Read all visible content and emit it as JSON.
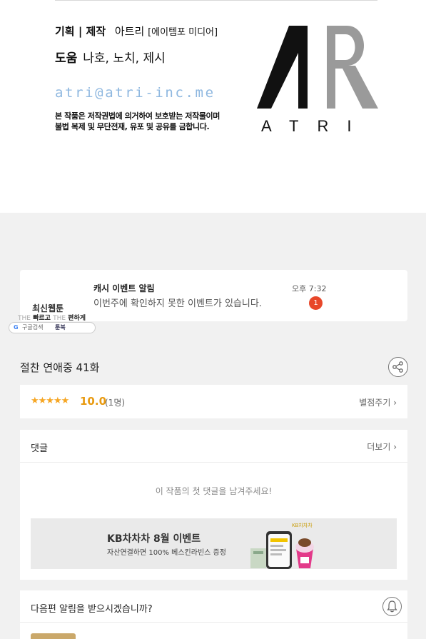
{
  "credits": {
    "plan_label": "기획 | 제작",
    "plan_value": "아트리",
    "plan_extra": "[에이템포 미디어]",
    "help_label": "도움",
    "help_value": "나호, 노치, 제시",
    "email": "atri@atri-inc.me",
    "notice_line1": "본 작품은 저작권법에 의거하여 보호받는 저작물이며",
    "notice_line2": "불법 복제 및 무단전재, 유포 및 공유를 금합니다.",
    "logo_text": "ATRI"
  },
  "notification": {
    "title": "캐시 이벤트 알림",
    "body": "이번주에 확인하지 못한 이벤트가 있습니다.",
    "time": "오후 7:32",
    "badge": "1"
  },
  "ad_logo": {
    "title": "최신웹툰",
    "tagline_a": "THE",
    "tagline_b": "빠르고",
    "tagline_c": "THE",
    "tagline_d": "편하게",
    "pill_search": "구글검색",
    "pill_name": "툰북"
  },
  "episode": {
    "title": "절찬 연애중 41화"
  },
  "rating": {
    "stars": "★★★★★",
    "score": "10.0",
    "count": "(1명)",
    "rate_link": "별점주기 ›"
  },
  "comments": {
    "title": "댓글",
    "more": "더보기 ›",
    "empty": "이 작품의 첫 댓글을 남겨주세요!"
  },
  "banner": {
    "title": "KB차차차 8월 이벤트",
    "subtitle": "자산연결하면 100% 베스킨라빈스 증정",
    "brand_tag": "KB차차차"
  },
  "alert": {
    "text": "다음편 알림을 받으시겠습니까?"
  }
}
